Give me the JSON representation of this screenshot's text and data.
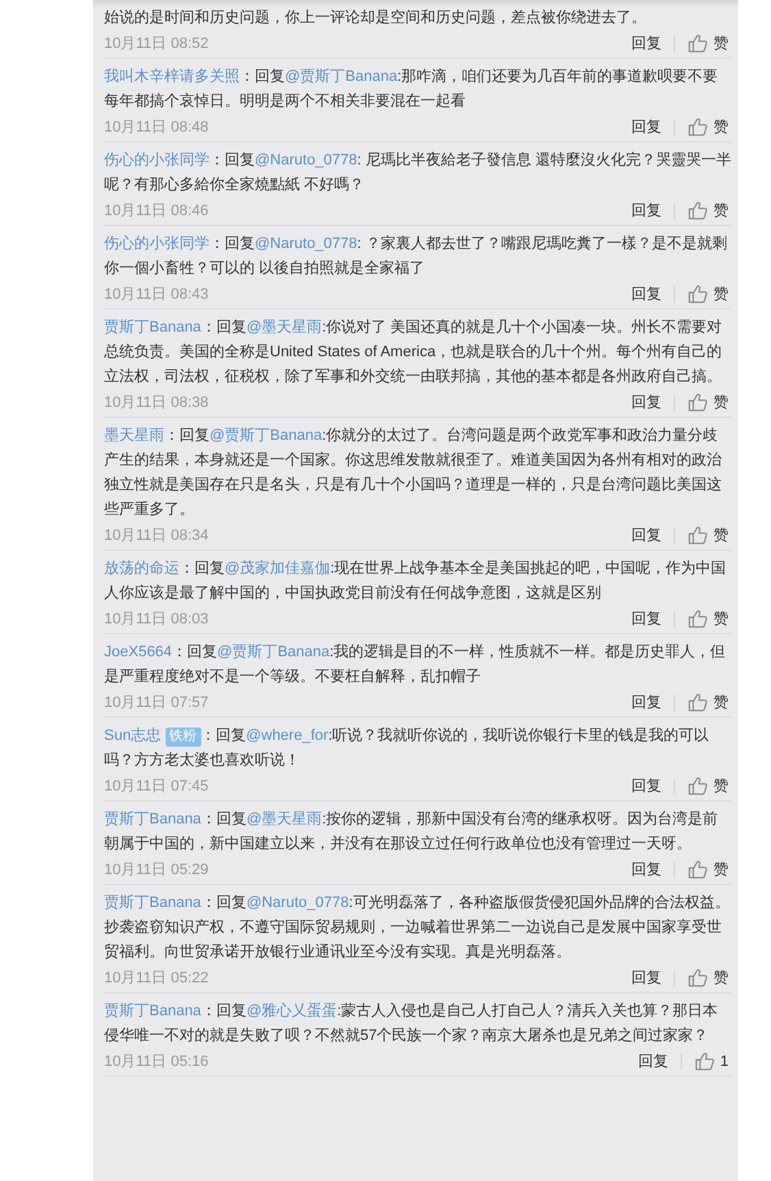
{
  "comments": [
    {
      "text": "始说的是时间和历史问题，你上一评论却是空间和历史问题，差点被你绕进去了。",
      "time": "10月11日 08:52",
      "reply": "回复",
      "like": "赞"
    },
    {
      "user": "我叫木辛梓请多关照",
      "reply_label": "：回复",
      "mention": "@贾斯丁Banana",
      "text": ":那咋滴，咱们还要为几百年前的事道歉呗要不要每年都搞个哀悼日。明明是两个不相关非要混在一起看",
      "time": "10月11日 08:48",
      "reply": "回复",
      "like": "赞"
    },
    {
      "user": "伤心的小张同学",
      "reply_label": "：回复",
      "mention": "@Naruto_0778",
      "text": ": 尼瑪比半夜給老子發信息 還特麼沒火化完？哭靈哭一半呢？有那心多給你全家燒點紙 不好嗎？",
      "time": "10月11日 08:46",
      "reply": "回复",
      "like": "赞"
    },
    {
      "user": "伤心的小张同学",
      "reply_label": "：回复",
      "mention": "@Naruto_0778",
      "text": ": ？家裏人都去世了？嘴跟尼瑪吃糞了一樣？是不是就剩你一個小畜牲？可以的 以後自拍照就是全家福了",
      "time": "10月11日 08:43",
      "reply": "回复",
      "like": "赞"
    },
    {
      "user": "贾斯丁Banana",
      "reply_label": "：回复",
      "mention": "@墨天星雨",
      "text": ":你说对了 美国还真的就是几十个小国凑一块。州长不需要对总统负责。美国的全称是United States of America，也就是联合的几十个州。每个州有自己的立法权，司法权，征税权，除了军事和外交统一由联邦搞，其他的基本都是各州政府自己搞。",
      "time": "10月11日 08:38",
      "reply": "回复",
      "like": "赞"
    },
    {
      "user": "墨天星雨",
      "reply_label": "：回复",
      "mention": "@贾斯丁Banana",
      "text": ":你就分的太过了。台湾问题是两个政党军事和政治力量分歧产生的结果，本身就还是一个国家。你这思维发散就很歪了。难道美国因为各州有相对的政治独立性就是美国存在只是名头，只是有几十个小国吗？道理是一样的，只是台湾问题比美国这些严重多了。",
      "time": "10月11日 08:34",
      "reply": "回复",
      "like": "赞"
    },
    {
      "user": "放荡的命运",
      "reply_label": "：回复",
      "mention": "@茂家加佳嘉伽",
      "text": ":现在世界上战争基本全是美国挑起的吧，中国呢，作为中国人你应该是最了解中国的，中国执政党目前没有任何战争意图，这就是区别",
      "time": "10月11日 08:03",
      "reply": "回复",
      "like": "赞"
    },
    {
      "user": "JoeX5664",
      "reply_label": "：回复",
      "mention": "@贾斯丁Banana",
      "text": ":我的逻辑是目的不一样，性质就不一样。都是历史罪人，但是严重程度绝对不是一个等级。不要枉自解释，乱扣帽子",
      "time": "10月11日 07:57",
      "reply": "回复",
      "like": "赞"
    },
    {
      "user": "Sun志忠",
      "badge": "铁粉",
      "reply_label": "：回复",
      "mention": "@where_for",
      "text": ":听说？我就听你说的，我听说你银行卡里的钱是我的可以吗？方方老太婆也喜欢听说！",
      "time": "10月11日 07:45",
      "reply": "回复",
      "like": "赞"
    },
    {
      "user": "贾斯丁Banana",
      "reply_label": "：回复",
      "mention": "@墨天星雨",
      "text": ":按你的逻辑，那新中国没有台湾的继承权呀。因为台湾是前朝属于中国的，新中国建立以来，并没有在那设立过任何行政单位也没有管理过一天呀。",
      "time": "10月11日 05:29",
      "reply": "回复",
      "like": "赞"
    },
    {
      "user": "贾斯丁Banana",
      "reply_label": "：回复",
      "mention": "@Naruto_0778",
      "text": ":可光明磊落了，各种盗版假货侵犯国外品牌的合法权益。抄袭盗窃知识产权，不遵守国际贸易规则，一边喊着世界第二一边说自己是发展中国家享受世贸福利。向世贸承诺开放银行业通讯业至今没有实现。真是光明磊落。",
      "time": "10月11日 05:22",
      "reply": "回复",
      "like": "赞"
    },
    {
      "user": "贾斯丁Banana",
      "reply_label": "：回复",
      "mention": "@雅心乂蛋蛋",
      "text": ":蒙古人入侵也是自己人打自己人？清兵入关也算？那日本侵华唯一不对的就是失败了呗？不然就57个民族一个家？南京大屠杀也是兄弟之间过家家？",
      "time": "10月11日 05:16",
      "reply": "回复",
      "like": "1"
    }
  ]
}
